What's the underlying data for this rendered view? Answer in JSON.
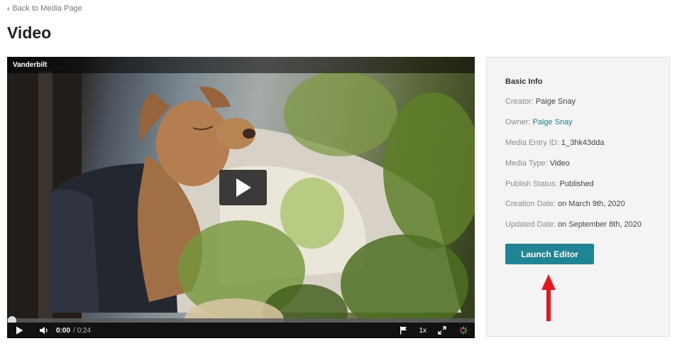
{
  "nav": {
    "back_label": "Back to Media Page"
  },
  "page": {
    "title": "Video"
  },
  "player": {
    "label": "Vanderbilt",
    "current_time": "0:00",
    "total_time": "/ 0:24",
    "progress_fraction": 0.0,
    "speed": "1x"
  },
  "info": {
    "heading": "Basic Info",
    "rows": [
      {
        "label": "Creator:",
        "value": "Paige Snay"
      },
      {
        "label": "Owner:",
        "value": "Paige Snay",
        "is_link": true
      },
      {
        "label": "Media Entry ID:",
        "value": "1_3hk43dda"
      },
      {
        "label": "Media Type:",
        "value": "Video"
      },
      {
        "label": "Publish Status:",
        "value": "Published"
      },
      {
        "label": "Creation Date:",
        "value": "on March 9th, 2020"
      },
      {
        "label": "Updated Date:",
        "value": "on September 8th, 2020"
      }
    ],
    "launch_button": "Launch Editor"
  },
  "colors": {
    "accent": "#1f8494",
    "link": "#1b7f93",
    "annotation_arrow": "#e8141e",
    "panel_bg": "#f4f4f4"
  },
  "icons": [
    "chevron-left-icon",
    "play-icon",
    "volume-icon",
    "flag-icon",
    "fullscreen-icon",
    "kaltura-logo-icon"
  ]
}
